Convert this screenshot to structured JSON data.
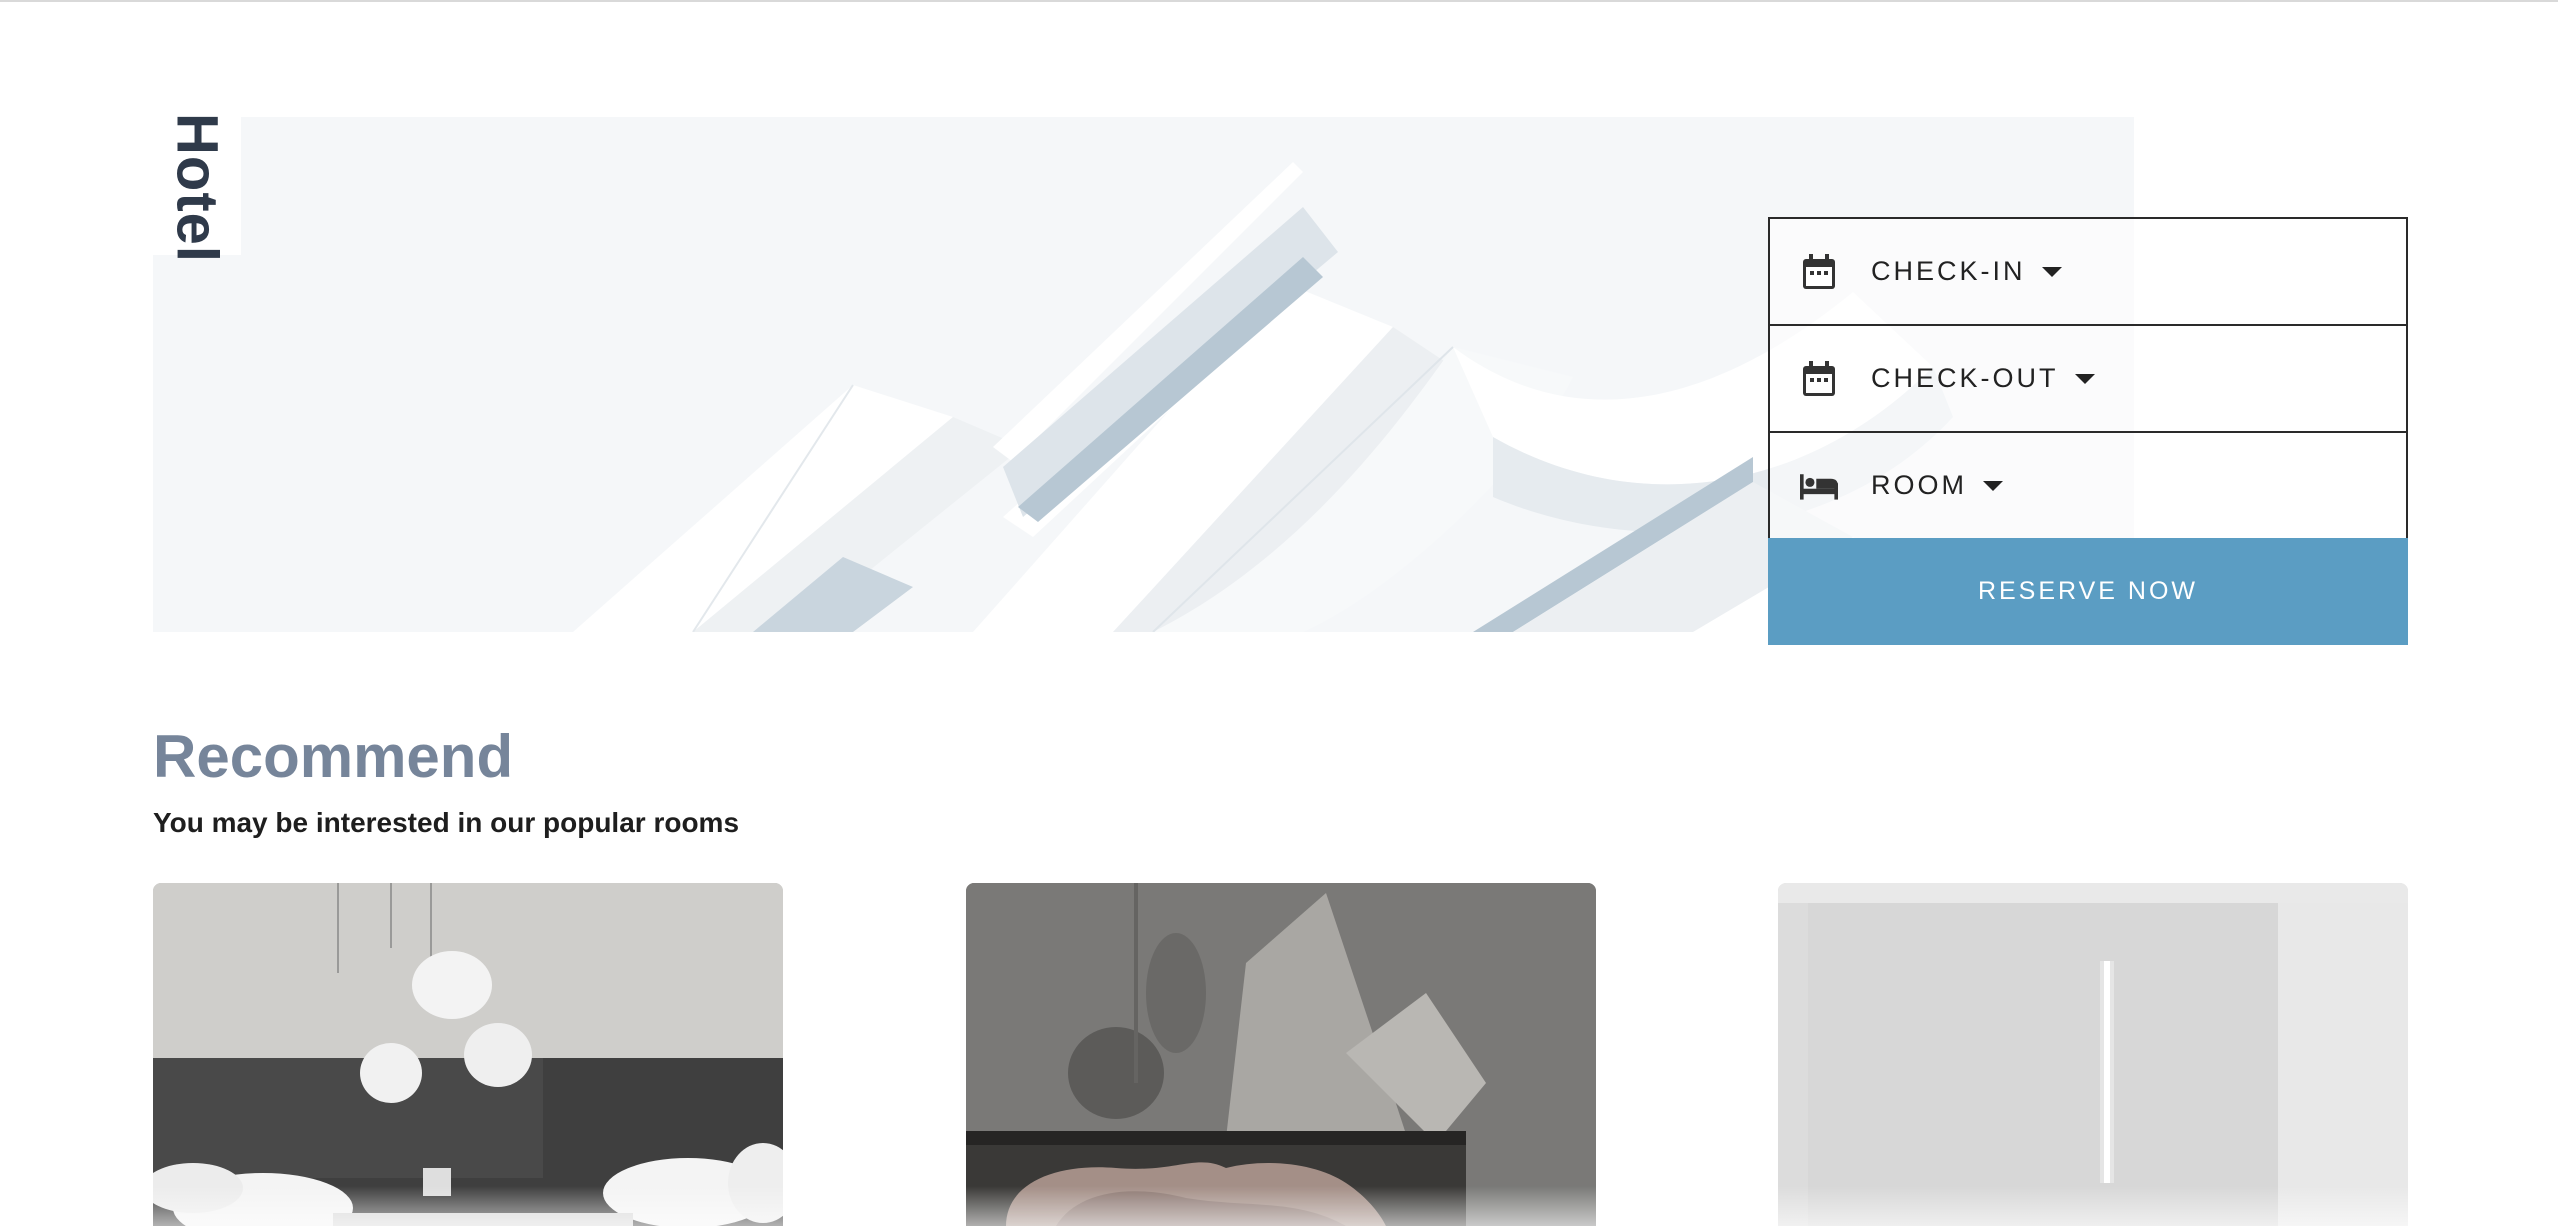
{
  "brand": {
    "name": "Hotel"
  },
  "booking": {
    "checkin": {
      "label": "CHECK-IN",
      "icon": "calendar-icon"
    },
    "checkout": {
      "label": "CHECK-OUT",
      "icon": "calendar-icon"
    },
    "room": {
      "label": "ROOM",
      "icon": "bed-icon"
    },
    "reserve_label": "RESERVE NOW"
  },
  "recommend": {
    "title": "Recommend",
    "subtitle": "You may be interested in our popular rooms"
  },
  "colors": {
    "accent": "#5b9dc3",
    "heading": "#76859a",
    "brand": "#2f3a4a"
  }
}
